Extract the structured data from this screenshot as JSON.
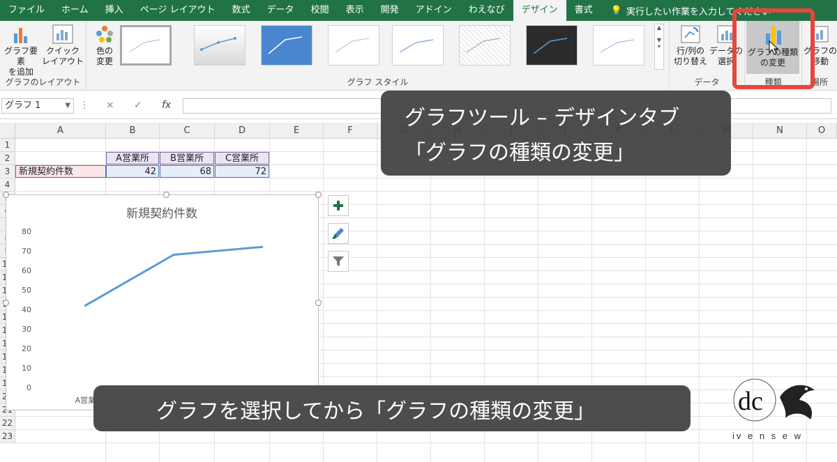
{
  "ribbon_tabs": [
    "ファイル",
    "ホーム",
    "挿入",
    "ページ レイアウト",
    "数式",
    "データ",
    "校閲",
    "表示",
    "開発",
    "アドイン",
    "わえなび",
    "デザイン",
    "書式"
  ],
  "active_tab": "デザイン",
  "tell_me": "実行したい作業を入力してください",
  "groups": {
    "layout": {
      "label": "グラフのレイアウト",
      "add_element": [
        "グラフ要素",
        "を追加"
      ],
      "quick_layout": [
        "クイック",
        "レイアウト"
      ]
    },
    "styles": {
      "label": "グラフ スタイル",
      "change_color": [
        "色の",
        "変更"
      ]
    },
    "data": {
      "label": "データ",
      "switch_row_col": [
        "行/列の",
        "切り替え"
      ],
      "select_data": [
        "データの",
        "選択"
      ]
    },
    "type": {
      "label": "種類",
      "change_type": [
        "グラフの種類",
        "の変更"
      ]
    },
    "location": {
      "label": "場所",
      "move_chart": [
        "グラフの",
        "移動"
      ]
    }
  },
  "formula_bar": {
    "name_box": "グラフ 1",
    "cancel": "×",
    "enter": "✓",
    "fx": "fx"
  },
  "columns": [
    "A",
    "B",
    "C",
    "D",
    "E",
    "F",
    "G",
    "H",
    "I",
    "J",
    "K",
    "L",
    "M",
    "N",
    "O"
  ],
  "rows": [
    "1",
    "2",
    "3",
    "4",
    "5",
    "6",
    "7",
    "8",
    "9",
    "10",
    "11",
    "12",
    "13",
    "14",
    "15",
    "16",
    "17",
    "18",
    "19",
    "20",
    "21",
    "22",
    "23"
  ],
  "table": {
    "headers": [
      "A営業所",
      "B営業所",
      "C営業所"
    ],
    "row_label": "新規契約件数",
    "values": [
      "42",
      "68",
      "72"
    ]
  },
  "chart_data": {
    "type": "line",
    "title": "新規契約件数",
    "categories": [
      "A営業所",
      "B営業所",
      "C営業所"
    ],
    "visible_category_label": "A営業",
    "values": [
      42,
      68,
      72
    ],
    "ylim": [
      0,
      80
    ],
    "yticks": [
      "0",
      "10",
      "20",
      "30",
      "40",
      "50",
      "60",
      "70",
      "80"
    ],
    "line_color": "#5b9bd5",
    "grid": false,
    "legend": "none"
  },
  "callouts": {
    "top_line1": "グラフツール – デザインタブ",
    "top_line2": "「グラフの種類の変更」",
    "bottom": "グラフを選択してから「グラフの種類の変更」"
  },
  "colors": {
    "excel_green": "#217346",
    "highlight": "#e8453c",
    "series": "#5b9bd5"
  },
  "logo_text": "iv e n s e w"
}
